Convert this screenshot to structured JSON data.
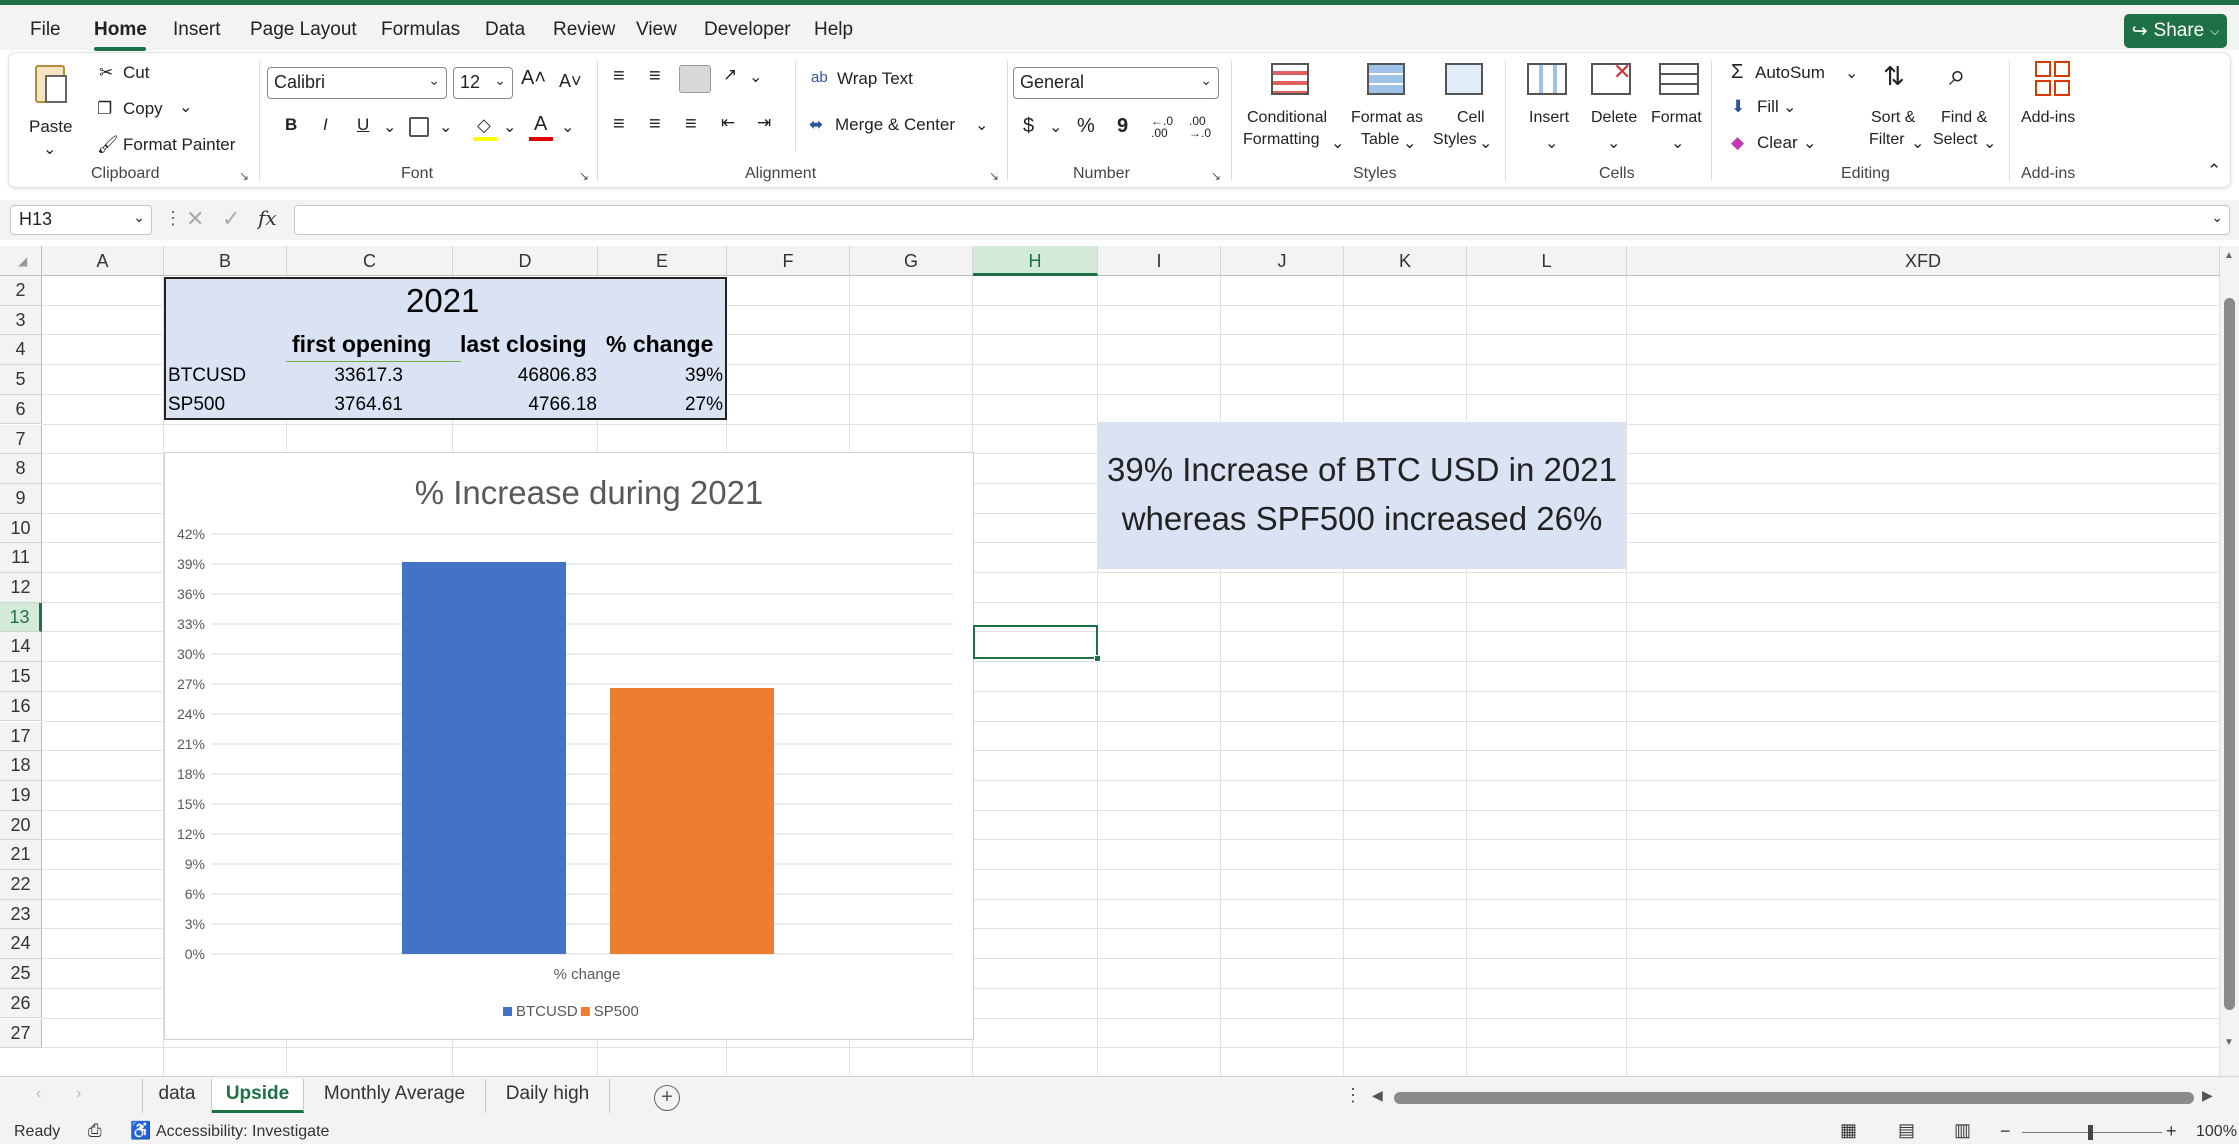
{
  "menu": {
    "items": [
      "File",
      "Home",
      "Insert",
      "Page Layout",
      "Formulas",
      "Data",
      "Review",
      "View",
      "Developer",
      "Help"
    ],
    "share": "Share"
  },
  "ribbon": {
    "clipboard": {
      "paste": "Paste",
      "cut": "Cut",
      "copy": "Copy",
      "format_painter": "Format Painter",
      "label": "Clipboard"
    },
    "font": {
      "font_name": "Calibri",
      "font_size": "12",
      "bold": "B",
      "italic": "I",
      "underline": "U",
      "label": "Font"
    },
    "alignment": {
      "wrap_text": "Wrap Text",
      "merge_center": "Merge & Center",
      "label": "Alignment"
    },
    "number": {
      "format": "General",
      "currency": "$",
      "percent": "%",
      "comma": "9",
      "label": "Number"
    },
    "styles": {
      "conditional": "Conditional",
      "conditional2": "Formatting",
      "format_table": "Format as",
      "format_table2": "Table",
      "cell_styles": "Cell",
      "cell_styles2": "Styles",
      "label": "Styles"
    },
    "cells": {
      "insert": "Insert",
      "delete": "Delete",
      "format": "Format",
      "label": "Cells"
    },
    "editing": {
      "autosum": "AutoSum",
      "fill": "Fill",
      "clear": "Clear",
      "sort": "Sort &",
      "sort2": "Filter",
      "find": "Find &",
      "find2": "Select",
      "label": "Editing"
    },
    "addins": {
      "addins": "Add-ins",
      "label": "Add-ins"
    }
  },
  "formula_bar": {
    "name_box": "H13",
    "fx": "fx",
    "formula": ""
  },
  "grid": {
    "columns": [
      "A",
      "B",
      "C",
      "D",
      "E",
      "F",
      "G",
      "H",
      "I",
      "J",
      "K",
      "L",
      "XFD"
    ],
    "rows": [
      "2",
      "3",
      "4",
      "5",
      "6",
      "7",
      "8",
      "9",
      "10",
      "11",
      "12",
      "13",
      "14",
      "15",
      "16",
      "17",
      "18",
      "19",
      "20",
      "21",
      "22",
      "23",
      "24",
      "25",
      "26",
      "27"
    ],
    "selected_cell": "H13"
  },
  "table": {
    "year": "2021",
    "headers": [
      "first opening",
      "last closing",
      "% change"
    ],
    "rows": [
      {
        "name": "BTCUSD",
        "first_opening": "33617.3",
        "last_closing": "46806.83",
        "change": "39%"
      },
      {
        "name": "SP500",
        "first_opening": "3764.61",
        "last_closing": "4766.18",
        "change": "27%"
      }
    ]
  },
  "note": {
    "line1": "39% Increase of BTC USD in 2021",
    "line2": "whereas SPF500 increased 26%"
  },
  "chart_data": {
    "type": "bar",
    "title": "% Increase during 2021",
    "categories": [
      "% change"
    ],
    "series": [
      {
        "name": "BTCUSD",
        "values": [
          39.2
        ],
        "color": "#4472c4"
      },
      {
        "name": "SP500",
        "values": [
          26.6
        ],
        "color": "#ed7d31"
      }
    ],
    "ylim": [
      0,
      42
    ],
    "yticks": [
      "0%",
      "3%",
      "6%",
      "9%",
      "12%",
      "15%",
      "18%",
      "21%",
      "24%",
      "27%",
      "30%",
      "33%",
      "36%",
      "39%",
      "42%"
    ],
    "xlabel": "% change",
    "ylabel": "",
    "grid": true,
    "legend": "bottom"
  },
  "sheets": {
    "tabs": [
      "data",
      "Upside",
      "Monthly Average",
      "Daily high"
    ],
    "active": "Upside"
  },
  "status": {
    "ready": "Ready",
    "accessibility": "Accessibility: Investigate",
    "zoom": "100%"
  }
}
